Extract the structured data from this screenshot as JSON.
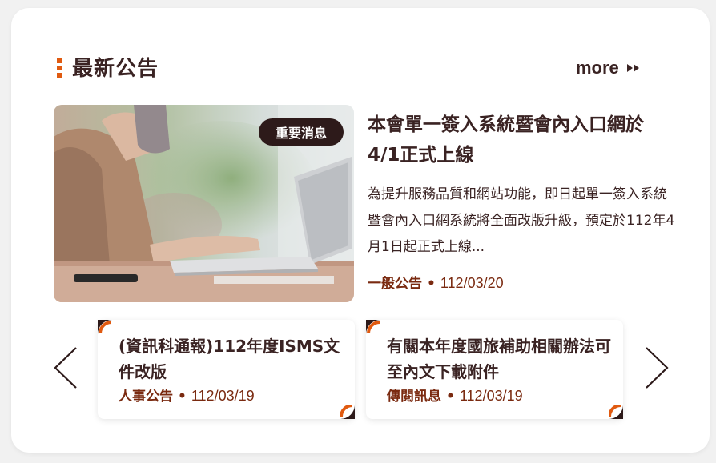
{
  "section": {
    "title": "最新公告",
    "more_label": "more"
  },
  "featured": {
    "badge": "重要消息",
    "title": "本會單一簽入系統暨會內入口網於4/1正式上線",
    "description": "為提升服務品質和網站功能，即日起單一簽入系統暨會內入口網系統將全面改版升級，預定於112年4月1日起正式上線...",
    "category": "一般公告",
    "separator": "•",
    "date": "112/03/20",
    "image_icon": "laptop-photo"
  },
  "news": [
    {
      "title": "(資訊科通報)112年度ISMS文件改版",
      "category": "人事公告",
      "separator": "•",
      "date": "112/03/19"
    },
    {
      "title": "有關本年度國旅補助相關辦法可至內文下載附件",
      "category": "傳閱訊息",
      "separator": "•",
      "date": "112/03/19"
    }
  ],
  "colors": {
    "accent": "#e05a10",
    "dark": "#2d1a1a",
    "text": "#3a2323",
    "meta": "#7a2a10"
  }
}
